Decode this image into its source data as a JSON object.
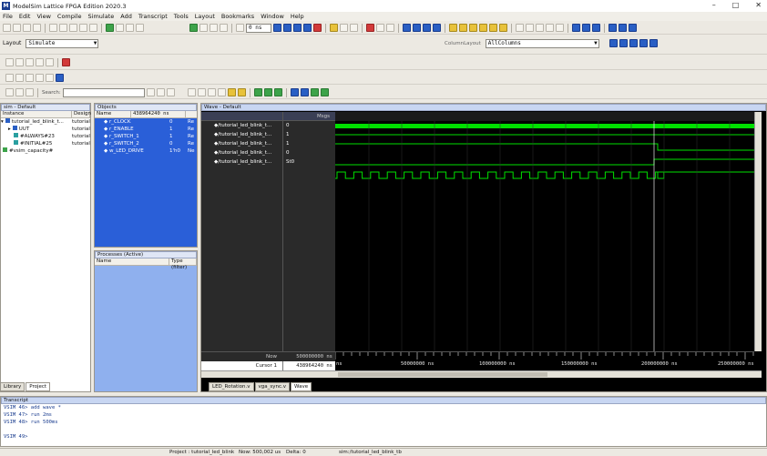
{
  "title": "ModelSim Lattice FPGA Edition 2020.3",
  "window_controls": [
    "–",
    "□",
    "✕"
  ],
  "menu": [
    "File",
    "Edit",
    "View",
    "Compile",
    "Simulate",
    "Add",
    "Transcript",
    "Tools",
    "Layout",
    "Bookmarks",
    "Window",
    "Help"
  ],
  "toolbar": {
    "layout_label": "Layout",
    "layout_value": "Simulate",
    "column_layout_label": "ColumnLayout",
    "column_layout_value": "AllColumns",
    "run_length": "0 ns",
    "search_label": "Search:",
    "search_value": ""
  },
  "sim_pane": {
    "title": "sim - Default",
    "columns": [
      "Instance",
      "Design"
    ],
    "rows": [
      {
        "name": "tutorial_led_blink_t...",
        "design": "tutorial",
        "indent": 0
      },
      {
        "name": "UUT",
        "design": "tutorial",
        "indent": 1
      },
      {
        "name": "#ALWAYS#23",
        "design": "tutorial",
        "indent": 1
      },
      {
        "name": "#INITIAL#25",
        "design": "tutorial",
        "indent": 1
      },
      {
        "name": "#vsim_capacity#",
        "design": "",
        "indent": 0
      }
    ],
    "tabs": [
      "Library",
      "Project"
    ]
  },
  "objects_pane": {
    "title": "Objects",
    "columns": [
      "Name",
      "Value",
      "Kind"
    ],
    "time_value": "438964240 ns",
    "rows": [
      {
        "name": "r_CLOCK",
        "value": "0",
        "kind": "Re"
      },
      {
        "name": "r_ENABLE",
        "value": "1",
        "kind": "Re"
      },
      {
        "name": "r_SWITCH_1",
        "value": "1",
        "kind": "Re"
      },
      {
        "name": "r_SWITCH_2",
        "value": "0",
        "kind": "Re"
      },
      {
        "name": "w_LED_DRIVE",
        "value": "1'h0",
        "kind": "Ne"
      }
    ]
  },
  "processes_pane": {
    "title": "Processes (Active)",
    "columns": [
      "Name",
      "Type (filter)"
    ]
  },
  "wave_pane": {
    "title": "Wave - Default",
    "msgs_header": "Msgs",
    "signals": [
      {
        "name": "/tutorial_led_blink_t...",
        "value": "0"
      },
      {
        "name": "/tutorial_led_blink_t...",
        "value": "1"
      },
      {
        "name": "/tutorial_led_blink_t...",
        "value": "1"
      },
      {
        "name": "/tutorial_led_blink_t...",
        "value": "0"
      },
      {
        "name": "/tutorial_led_blink_t...",
        "value": "St0"
      }
    ],
    "now_label": "Now",
    "now_value": "500000000 ns",
    "cursor_label": "Cursor 1",
    "cursor_value": "438964240 ns",
    "time_labels": [
      "ns",
      "50000000 ns",
      "100000000 ns",
      "150000000 ns",
      "200000000 ns",
      "250000000 ns"
    ],
    "tabs": [
      "LED_Rotation.v",
      "vga_sync.v",
      "Wave"
    ]
  },
  "transcript": {
    "title": "Transcript",
    "lines": [
      "VSIM 46> add wave *",
      "VSIM 47> run 2ms",
      "VSIM 48> run 500ms",
      "",
      "VSIM 49>"
    ]
  },
  "status": {
    "project": "Project : tutorial_led_blink",
    "now": "Now: 500,002 us",
    "delta": "Delta: 0",
    "path": "sim:/tutorial_led_blink_tb"
  },
  "colors": {
    "wave_bg": "#000000",
    "wave_signal": "#00ff00",
    "objects_bg": "#2a5fd8",
    "pane_header": "#c8d6f2"
  }
}
